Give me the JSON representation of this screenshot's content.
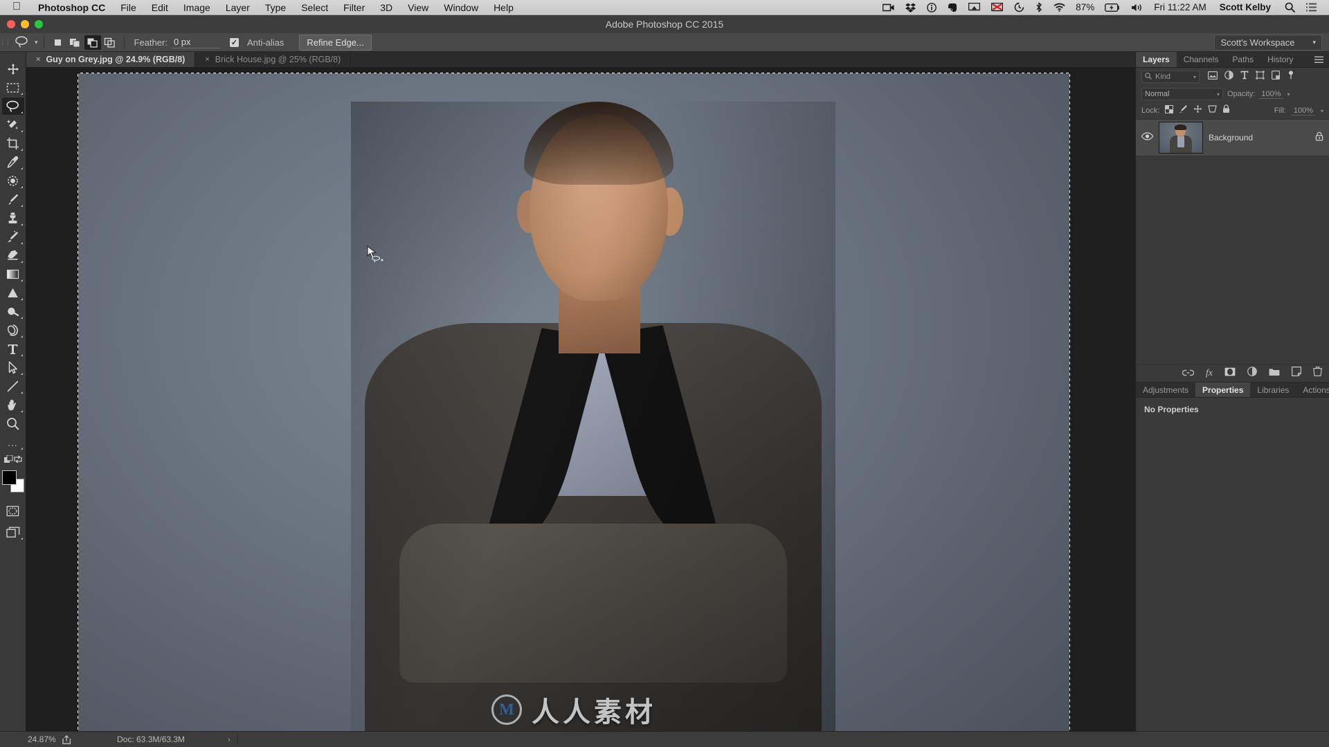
{
  "macbar": {
    "apple": "apple-logo",
    "app_name": "Photoshop CC",
    "menus": [
      "File",
      "Edit",
      "Image",
      "Layer",
      "Type",
      "Select",
      "Filter",
      "3D",
      "View",
      "Window",
      "Help"
    ],
    "status_icons": [
      "screen-recording-icon",
      "dropbox-icon",
      "info-icon",
      "evernote-icon",
      "airplay-icon",
      "display-off-icon",
      "time-machine-icon",
      "bluetooth-icon",
      "wifi-icon"
    ],
    "battery_percent": "87%",
    "battery_icon": "battery-charging-icon",
    "volume_icon": "volume-icon",
    "clock": "Fri 11:22 AM",
    "user_name": "Scott Kelby",
    "search_icon": "search-icon",
    "notification_icon": "notification-center-icon"
  },
  "window": {
    "title": "Adobe Photoshop CC 2015",
    "traffic_lights": [
      "close-button",
      "minimize-button",
      "zoom-button"
    ],
    "traffic_colors": [
      "#ff5f57",
      "#febc2e",
      "#28c840"
    ]
  },
  "options_bar": {
    "tool_icon": "lasso-tool-icon",
    "tool_preset_chevron": "chevron-down-icon",
    "selection_modes": [
      {
        "name": "new-selection",
        "active": false
      },
      {
        "name": "add-to-selection",
        "active": false
      },
      {
        "name": "subtract-from-selection",
        "active": true
      },
      {
        "name": "intersect-with-selection",
        "active": false
      }
    ],
    "feather_label": "Feather:",
    "feather_value": "0 px",
    "antialias_label": "Anti-alias",
    "antialias_checked": true,
    "refine_edge_label": "Refine Edge...",
    "workspace": "Scott's Workspace",
    "workspace_chevron": "chevron-down-icon"
  },
  "tabs": [
    {
      "label": "Guy on Grey.jpg @ 24.9% (RGB/8)",
      "active": true,
      "close": "×"
    },
    {
      "label": "Brick House.jpg @ 25% (RGB/8)",
      "active": false,
      "close": "×"
    }
  ],
  "toolbar": {
    "tools": [
      {
        "name": "move-tool",
        "active": false
      },
      {
        "name": "rectangular-marquee-tool",
        "active": false
      },
      {
        "name": "lasso-tool",
        "active": true
      },
      {
        "name": "quick-selection-tool",
        "active": false
      },
      {
        "name": "crop-tool",
        "active": false
      },
      {
        "name": "eyedropper-tool",
        "active": false
      },
      {
        "name": "spot-healing-brush-tool",
        "active": false
      },
      {
        "name": "brush-tool",
        "active": false
      },
      {
        "name": "clone-stamp-tool",
        "active": false
      },
      {
        "name": "history-brush-tool",
        "active": false
      },
      {
        "name": "eraser-tool",
        "active": false
      },
      {
        "name": "gradient-tool",
        "active": false
      },
      {
        "name": "blur-tool",
        "active": false
      },
      {
        "name": "dodge-tool",
        "active": false
      },
      {
        "name": "pen-tool",
        "active": false
      },
      {
        "name": "type-tool",
        "active": false
      },
      {
        "name": "path-selection-tool",
        "active": false
      },
      {
        "name": "line-tool",
        "active": false
      },
      {
        "name": "hand-tool",
        "active": false
      },
      {
        "name": "zoom-tool",
        "active": false
      }
    ],
    "more_tools": "...",
    "quick_mask": "quick-mask-mode-icon",
    "screen_mode": "screen-mode-icon",
    "foreground_color": "#000000",
    "background_color": "#ffffff"
  },
  "layers_panel": {
    "tabs": [
      {
        "label": "Layers",
        "active": true
      },
      {
        "label": "Channels",
        "active": false
      },
      {
        "label": "Paths",
        "active": false
      },
      {
        "label": "History",
        "active": false
      }
    ],
    "menu_icon": "panel-menu-icon",
    "filter_kind": "Kind",
    "filter_search_icon": "search-icon",
    "filter_icons": [
      "filter-pixel-icon",
      "filter-adjustment-icon",
      "filter-type-icon",
      "filter-shape-icon",
      "filter-smart-object-icon",
      "filter-toggle-icon"
    ],
    "blend_mode": "Normal",
    "opacity_label": "Opacity:",
    "opacity_value": "100%",
    "lock_label": "Lock:",
    "lock_icons": [
      "lock-transparent-pixels-icon",
      "lock-image-pixels-icon",
      "lock-position-icon",
      "lock-artboard-icon",
      "lock-all-icon"
    ],
    "fill_label": "Fill:",
    "fill_value": "100%",
    "layers": [
      {
        "name": "Background",
        "visible": true,
        "locked": true,
        "eye_icon": "eye-icon",
        "lock_icon": "lock-icon"
      }
    ],
    "footer_icons": [
      "link-layers-icon",
      "layer-style-fx-icon",
      "layer-mask-icon",
      "new-adjustment-layer-icon",
      "new-group-icon",
      "new-layer-icon",
      "delete-layer-icon"
    ]
  },
  "properties_panel": {
    "tabs": [
      {
        "label": "Adjustments",
        "active": false
      },
      {
        "label": "Properties",
        "active": true
      },
      {
        "label": "Libraries",
        "active": false
      },
      {
        "label": "Actions",
        "active": false
      }
    ],
    "menu_icon": "panel-menu-icon",
    "content": "No Properties"
  },
  "status_bar": {
    "zoom": "24.87%",
    "share_icon": "share-icon",
    "doc_info": "Doc: 63.3M/63.3M",
    "expand_arrow": "›"
  },
  "canvas": {
    "watermark_text": "人人素材",
    "watermark_logo": "rr-logo-icon",
    "selection_active": true,
    "cursor_icon": "lasso-cursor-icon"
  }
}
